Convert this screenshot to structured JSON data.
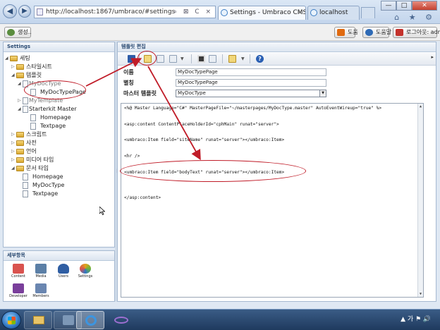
{
  "browser": {
    "address": "http://localhost:1867/umbraco/#settings",
    "address_search": "⌕ ⊠ C ×",
    "tabs": [
      {
        "title": "Settings - Umbraco CMS -..."
      },
      {
        "title": "localhost"
      }
    ],
    "window_controls": {
      "minimize": "—",
      "maximize": "□",
      "close": "✕"
    },
    "tools": "⌂ ★ ⚙"
  },
  "topbar": {
    "create_label": "생성..",
    "help_label": "도움",
    "about_label": "도움말",
    "logout_label": "로그아웃: admin"
  },
  "tree_panel": {
    "title": "Settings",
    "nodes": [
      {
        "label": "세팅"
      },
      {
        "label": "스타일시트"
      },
      {
        "label": "템플릿"
      },
      {
        "label": "MyDocType"
      },
      {
        "label": "MyDocTypePage"
      },
      {
        "label": "MyTemplate"
      },
      {
        "label": "Starterkit Master"
      },
      {
        "label": "Homepage"
      },
      {
        "label": "Textpage"
      },
      {
        "label": "스크립트"
      },
      {
        "label": "사전"
      },
      {
        "label": "언어"
      },
      {
        "label": "미디어 타입"
      },
      {
        "label": "문서 타입"
      },
      {
        "label": "Homepage"
      },
      {
        "label": "MyDocType"
      },
      {
        "label": "Textpage"
      }
    ]
  },
  "sections_panel": {
    "title": "세부항목",
    "apps": [
      {
        "label": "Content",
        "color": "#d9534f"
      },
      {
        "label": "Media",
        "color": "#5b7fa6"
      },
      {
        "label": "Users",
        "color": "#2f5ea3"
      },
      {
        "label": "Settings",
        "color": "#e3a21a"
      },
      {
        "label": "Developer",
        "color": "#7a3f9b"
      },
      {
        "label": "Members",
        "color": "#6a86b0"
      }
    ]
  },
  "editor": {
    "title": "템플릿 편집",
    "help_glyph": "?",
    "scroll_glyph": "▸",
    "properties": {
      "name_label": "이름",
      "name_value": "MyDocTypePage",
      "alias_label": "별칭",
      "alias_value": "MyDocTypePage",
      "master_label": "마스터 템플릿",
      "master_value": "MyDocType"
    },
    "code_lines": [
      "<%@ Master Language=\"C#\" MasterPageFile=\"~/masterpages/MyDocType.master\" AutoEventWireup=\"true\" %>",
      "<asp:content ContentPlaceHolderId=\"cphMain\" runat=\"server\">",
      "<umbraco:Item field=\"siteName\" runat=\"server\"></umbraco:Item>",
      "<hr />",
      "<umbraco:Item field=\"bodyText\" runat=\"server\"></umbraco:Item>",
      "</asp:content>"
    ]
  },
  "annotation_color": "#c01c28",
  "taskbar": {
    "tray_text": "▲ 가 ⚑ 🔊",
    "clock": ""
  }
}
